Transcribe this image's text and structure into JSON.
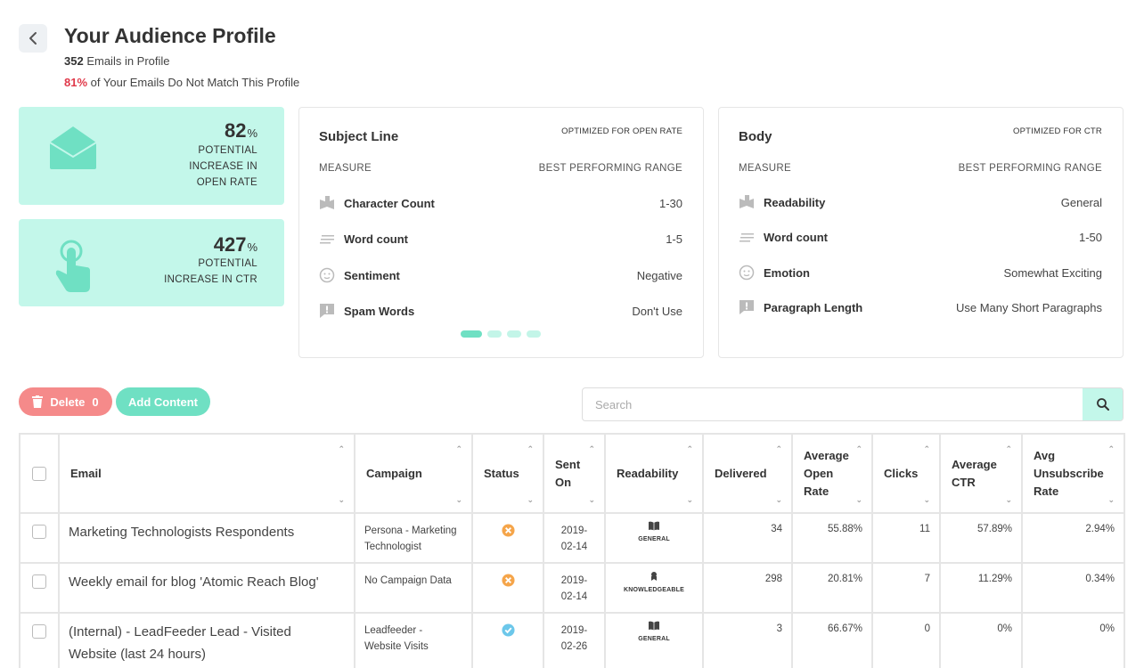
{
  "header": {
    "title": "Your Audience Profile",
    "emails_count": "352",
    "emails_label": "Emails in Profile",
    "mismatch_pct": "81%",
    "mismatch_label": "of Your Emails Do Not Match This Profile"
  },
  "stats": {
    "open_rate": {
      "value": "82",
      "unit": "%",
      "label_l1": "POTENTIAL",
      "label_l2": "INCREASE IN",
      "label_l3": "OPEN RATE"
    },
    "ctr": {
      "value": "427",
      "unit": "%",
      "label_l1": "POTENTIAL",
      "label_l2": "INCREASE IN CTR"
    }
  },
  "subject_panel": {
    "title": "Subject Line",
    "optimized": "OPTIMIZED FOR OPEN RATE",
    "col_measure": "MEASURE",
    "col_range": "BEST PERFORMING RANGE",
    "rows": [
      {
        "name": "Character Count",
        "value": "1-30"
      },
      {
        "name": "Word count",
        "value": "1-5"
      },
      {
        "name": "Sentiment",
        "value": "Negative"
      },
      {
        "name": "Spam Words",
        "value": "Don't Use"
      }
    ]
  },
  "body_panel": {
    "title": "Body",
    "optimized": "OPTIMIZED FOR CTR",
    "col_measure": "MEASURE",
    "col_range": "BEST PERFORMING RANGE",
    "rows": [
      {
        "name": "Readability",
        "value": "General"
      },
      {
        "name": "Word count",
        "value": "1-50"
      },
      {
        "name": "Emotion",
        "value": "Somewhat Exciting"
      },
      {
        "name": "Paragraph Length",
        "value": "Use Many Short Paragraphs"
      }
    ]
  },
  "actions": {
    "delete_label": "Delete",
    "delete_count": "0",
    "add_label": "Add Content",
    "search_placeholder": "Search"
  },
  "table": {
    "columns": {
      "email": "Email",
      "campaign": "Campaign",
      "status": "Status",
      "sent_on_l1": "Sent",
      "sent_on_l2": "On",
      "readability": "Readability",
      "delivered": "Delivered",
      "avg_open_l1": "Average",
      "avg_open_l2": "Open",
      "avg_open_l3": "Rate",
      "clicks": "Clicks",
      "avg_ctr_l1": "Average",
      "avg_ctr_l2": "CTR",
      "avg_unsub_l1": "Avg",
      "avg_unsub_l2": "Unsubscribe",
      "avg_unsub_l3": "Rate"
    },
    "rows": [
      {
        "email": "Marketing Technologists Respondents",
        "campaign_l1": "Persona - Marketing",
        "campaign_l2": "Technologist",
        "status": "error",
        "sent_l1": "2019-",
        "sent_l2": "02-14",
        "readability": "GENERAL",
        "delivered": "34",
        "open_rate": "55.88%",
        "clicks": "11",
        "ctr": "57.89%",
        "unsub": "2.94%"
      },
      {
        "email": "Weekly email for blog 'Atomic Reach Blog'",
        "campaign_l1": "No Campaign Data",
        "campaign_l2": "",
        "status": "error",
        "sent_l1": "2019-",
        "sent_l2": "02-14",
        "readability": "KNOWLEDGEABLE",
        "delivered": "298",
        "open_rate": "20.81%",
        "clicks": "7",
        "ctr": "11.29%",
        "unsub": "0.34%"
      },
      {
        "email_l1": "(Internal) - LeadFeeder Lead - Visited",
        "email_l2": "Website (last 24 hours)",
        "campaign_l1": "Leadfeeder -",
        "campaign_l2": "Website Visits",
        "status": "ok",
        "sent_l1": "2019-",
        "sent_l2": "02-26",
        "readability": "GENERAL",
        "delivered": "3",
        "open_rate": "66.67%",
        "clicks": "0",
        "ctr": "0%",
        "unsub": "0%"
      }
    ]
  },
  "colors": {
    "accent_mint": "#6fe0c3",
    "card_bg": "#c3f7ea",
    "danger": "#f58a8a",
    "mismatch_red": "#e0394a",
    "status_error": "#f5a54a",
    "status_ok": "#6cc7ea"
  }
}
